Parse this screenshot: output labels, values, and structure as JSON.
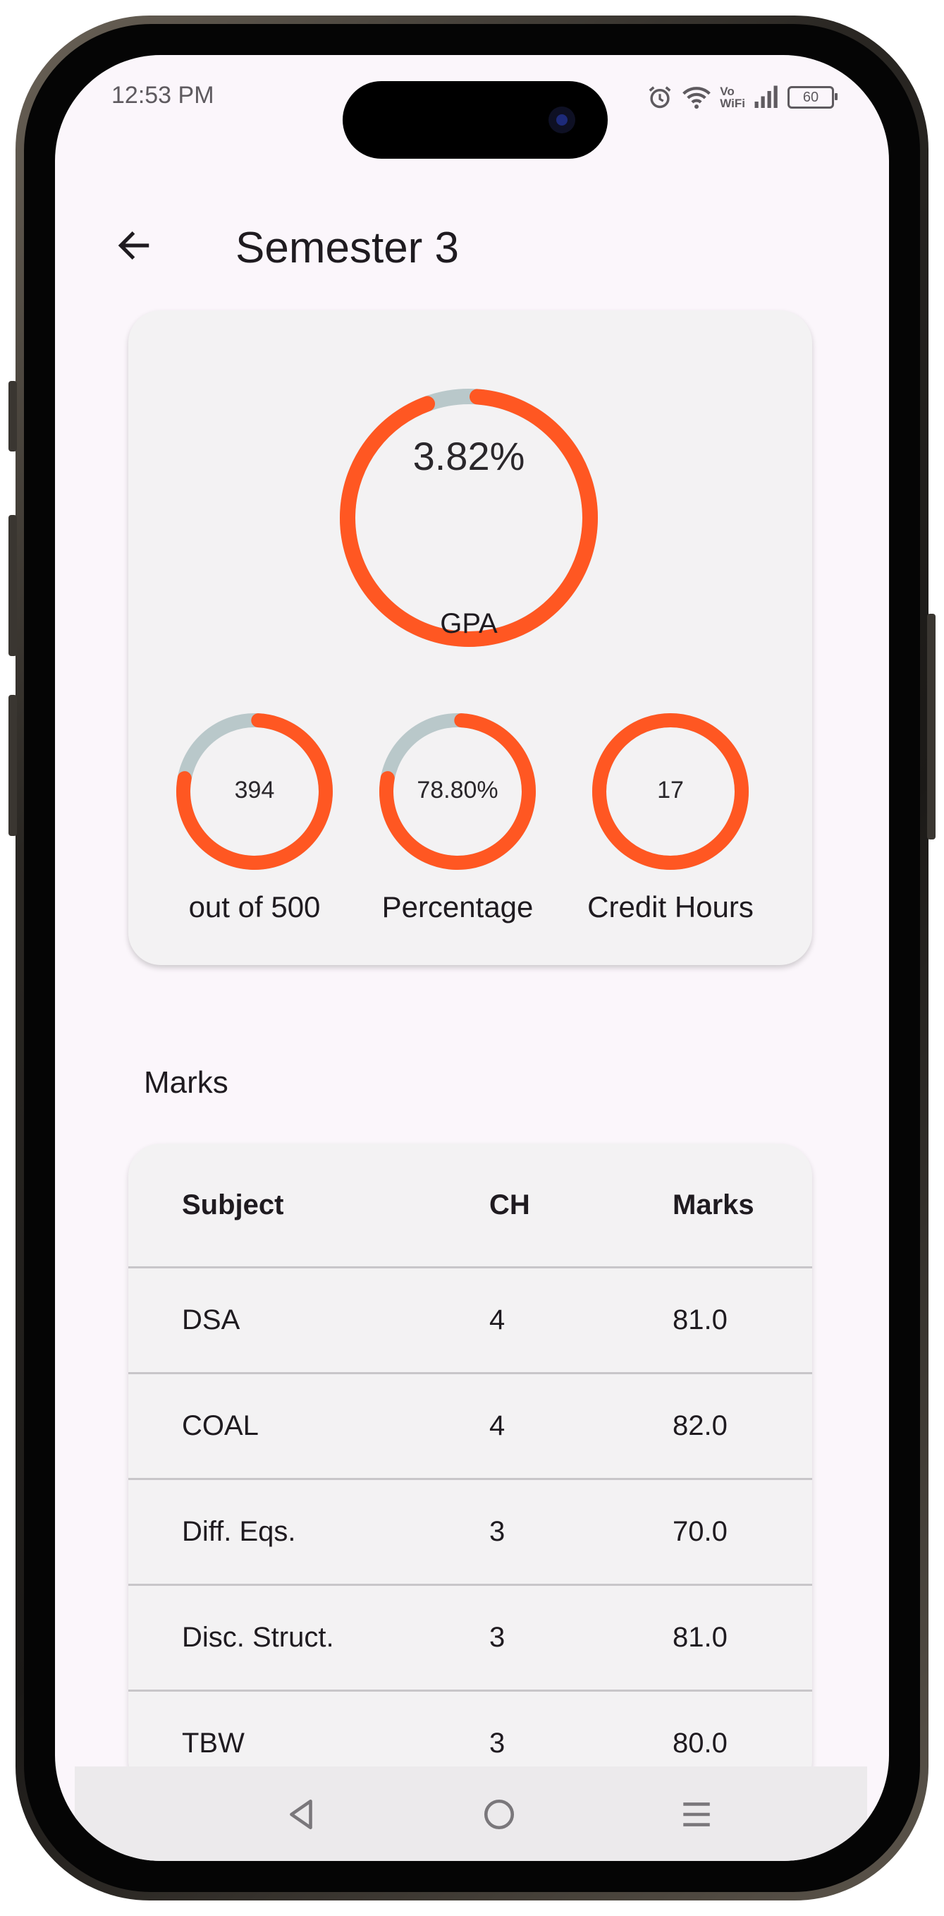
{
  "status_bar": {
    "time": "12:53 PM",
    "volte_label": "Vo\nWiFi",
    "battery_level": "60",
    "icons": [
      "alarm-icon",
      "wifi-icon",
      "vowifi-icon",
      "signal-icon",
      "battery-icon"
    ]
  },
  "app_bar": {
    "title": "Semester 3",
    "back_icon": "arrow-left-icon"
  },
  "summary": {
    "gpa": {
      "value_label": "3.82%",
      "caption": "GPA",
      "fraction": 0.955
    },
    "marks": {
      "value_label": "394",
      "caption": "out of 500",
      "fraction": 0.788
    },
    "percentage": {
      "value_label": "78.80%",
      "caption": "Percentage",
      "fraction": 0.788
    },
    "credit_hours": {
      "value_label": "17",
      "caption": "Credit Hours",
      "fraction": 1.0
    }
  },
  "marks_section": {
    "label": "Marks",
    "headers": {
      "subject": "Subject",
      "ch": "CH",
      "marks": "Marks"
    },
    "rows": [
      {
        "subject": "DSA",
        "ch": "4",
        "marks": "81.0"
      },
      {
        "subject": "COAL",
        "ch": "4",
        "marks": "82.0"
      },
      {
        "subject": "Diff. Eqs.",
        "ch": "3",
        "marks": "70.0"
      },
      {
        "subject": "Disc. Struct.",
        "ch": "3",
        "marks": "81.0"
      },
      {
        "subject": "TBW",
        "ch": "3",
        "marks": "80.0"
      }
    ]
  },
  "nav_bar": {
    "icons": [
      "back-triangle-icon",
      "home-circle-icon",
      "menu-lines-icon"
    ]
  },
  "colors": {
    "ring_progress": "#ff5722",
    "ring_track": "#b9c8ca",
    "background": "#fbf6fb",
    "card": "#f3f2f3",
    "text": "#1f1b20"
  }
}
